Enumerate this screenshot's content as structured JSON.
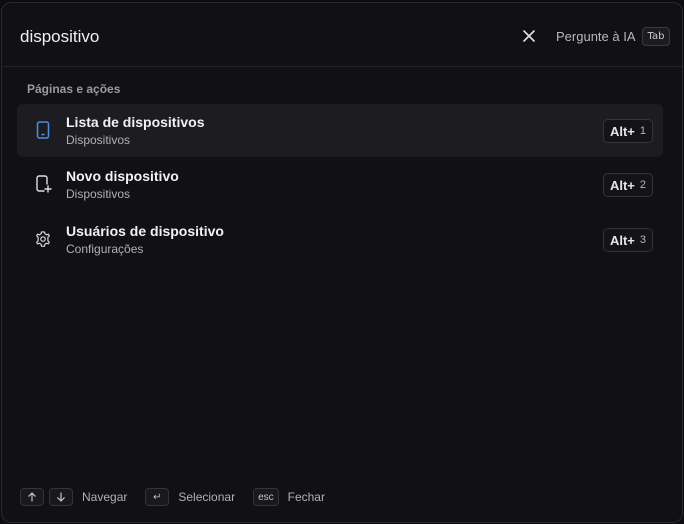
{
  "search": {
    "value": "dispositivo"
  },
  "header": {
    "ask_ai_label": "Pergunte à IA",
    "ask_ai_key": "Tab"
  },
  "section": {
    "label": "Páginas e ações"
  },
  "results": [
    {
      "title": "Lista de dispositivos",
      "subtitle": "Dispositivos",
      "shortcut_mod": "Alt+",
      "shortcut_num": "1",
      "icon": "smartphone-icon",
      "active": true
    },
    {
      "title": "Novo dispositivo",
      "subtitle": "Dispositivos",
      "shortcut_mod": "Alt+",
      "shortcut_num": "2",
      "icon": "add-device-icon",
      "active": false
    },
    {
      "title": "Usuários de dispositivo",
      "subtitle": "Configurações",
      "shortcut_mod": "Alt+",
      "shortcut_num": "3",
      "icon": "gear-icon",
      "active": false
    }
  ],
  "footer": {
    "navigate_label": "Navegar",
    "select_key": "↵",
    "select_label": "Selecionar",
    "close_key": "esc",
    "close_label": "Fechar"
  },
  "colors": {
    "accent_icon": "#4a8fe0",
    "active_row_bg": "#1d1d21"
  }
}
